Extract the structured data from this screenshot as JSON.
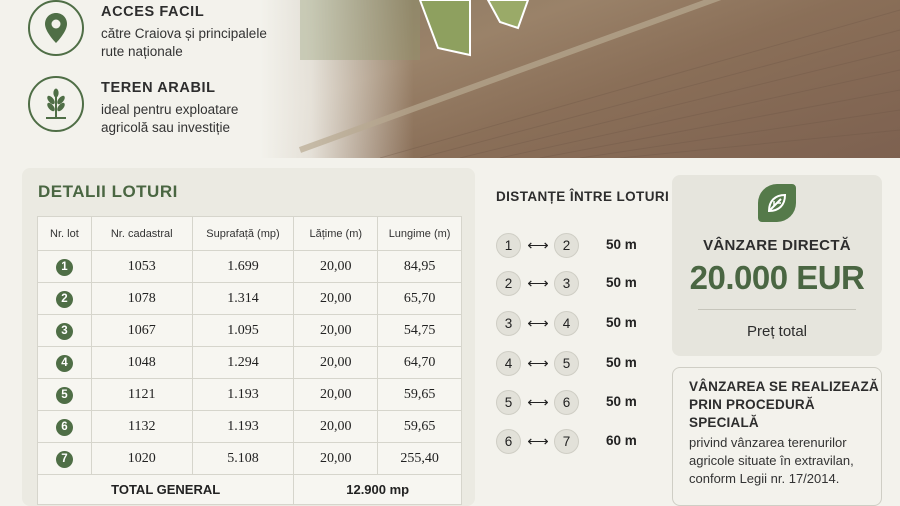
{
  "features": [
    {
      "title": "ACCES FACIL",
      "desc1": "către Craiova și principalele",
      "desc2": "rute naționale",
      "icon": "location-pin-icon"
    },
    {
      "title": "TEREN ARABIL",
      "desc1": "ideal pentru exploatare",
      "desc2": "agricolă sau investiție",
      "icon": "wheat-icon"
    }
  ],
  "details": {
    "title": "DETALII LOTURI",
    "headers": [
      "Nr. lot",
      "Nr. cadastral",
      "Suprafață (mp)",
      "Lățime (m)",
      "Lungime (m)"
    ],
    "rows": [
      {
        "lot": "1",
        "cadastral": "1053",
        "area": "1.699",
        "width": "20,00",
        "length": "84,95"
      },
      {
        "lot": "2",
        "cadastral": "1078",
        "area": "1.314",
        "width": "20,00",
        "length": "65,70"
      },
      {
        "lot": "3",
        "cadastral": "1067",
        "area": "1.095",
        "width": "20,00",
        "length": "54,75"
      },
      {
        "lot": "4",
        "cadastral": "1048",
        "area": "1.294",
        "width": "20,00",
        "length": "64,70"
      },
      {
        "lot": "5",
        "cadastral": "1121",
        "area": "1.193",
        "width": "20,00",
        "length": "59,65"
      },
      {
        "lot": "6",
        "cadastral": "1132",
        "area": "1.193",
        "width": "20,00",
        "length": "59,65"
      },
      {
        "lot": "7",
        "cadastral": "1020",
        "area": "5.108",
        "width": "20,00",
        "length": "255,40"
      }
    ],
    "total_label": "TOTAL GENERAL",
    "total_value": "12.900 mp"
  },
  "distances": {
    "title": "DISTANȚE ÎNTRE LOTURI",
    "arrow": "⟷",
    "items": [
      {
        "from": "1",
        "to": "2",
        "value": "50 m"
      },
      {
        "from": "2",
        "to": "3",
        "value": "50 m"
      },
      {
        "from": "3",
        "to": "4",
        "value": "50 m"
      },
      {
        "from": "4",
        "to": "5",
        "value": "50 m"
      },
      {
        "from": "5",
        "to": "6",
        "value": "50 m"
      },
      {
        "from": "6",
        "to": "7",
        "value": "60 m"
      }
    ]
  },
  "price": {
    "icon": "leaf-icon",
    "label": "VÂNZARE DIRECTĂ",
    "amount": "20.000 EUR",
    "sub": "Preț total"
  },
  "notice": {
    "title1": "VÂNZAREA SE REALIZEAZĂ",
    "title2": "PRIN PROCEDURĂ SPECIALĂ",
    "text1": "privind vânzarea terenurilor",
    "text2": "agricole situate în extravilan,",
    "text3": "conform Legii nr. 17/2014."
  },
  "colors": {
    "accent": "#4a6642",
    "badge": "#4f6e46",
    "background": "#f3f2ec"
  }
}
